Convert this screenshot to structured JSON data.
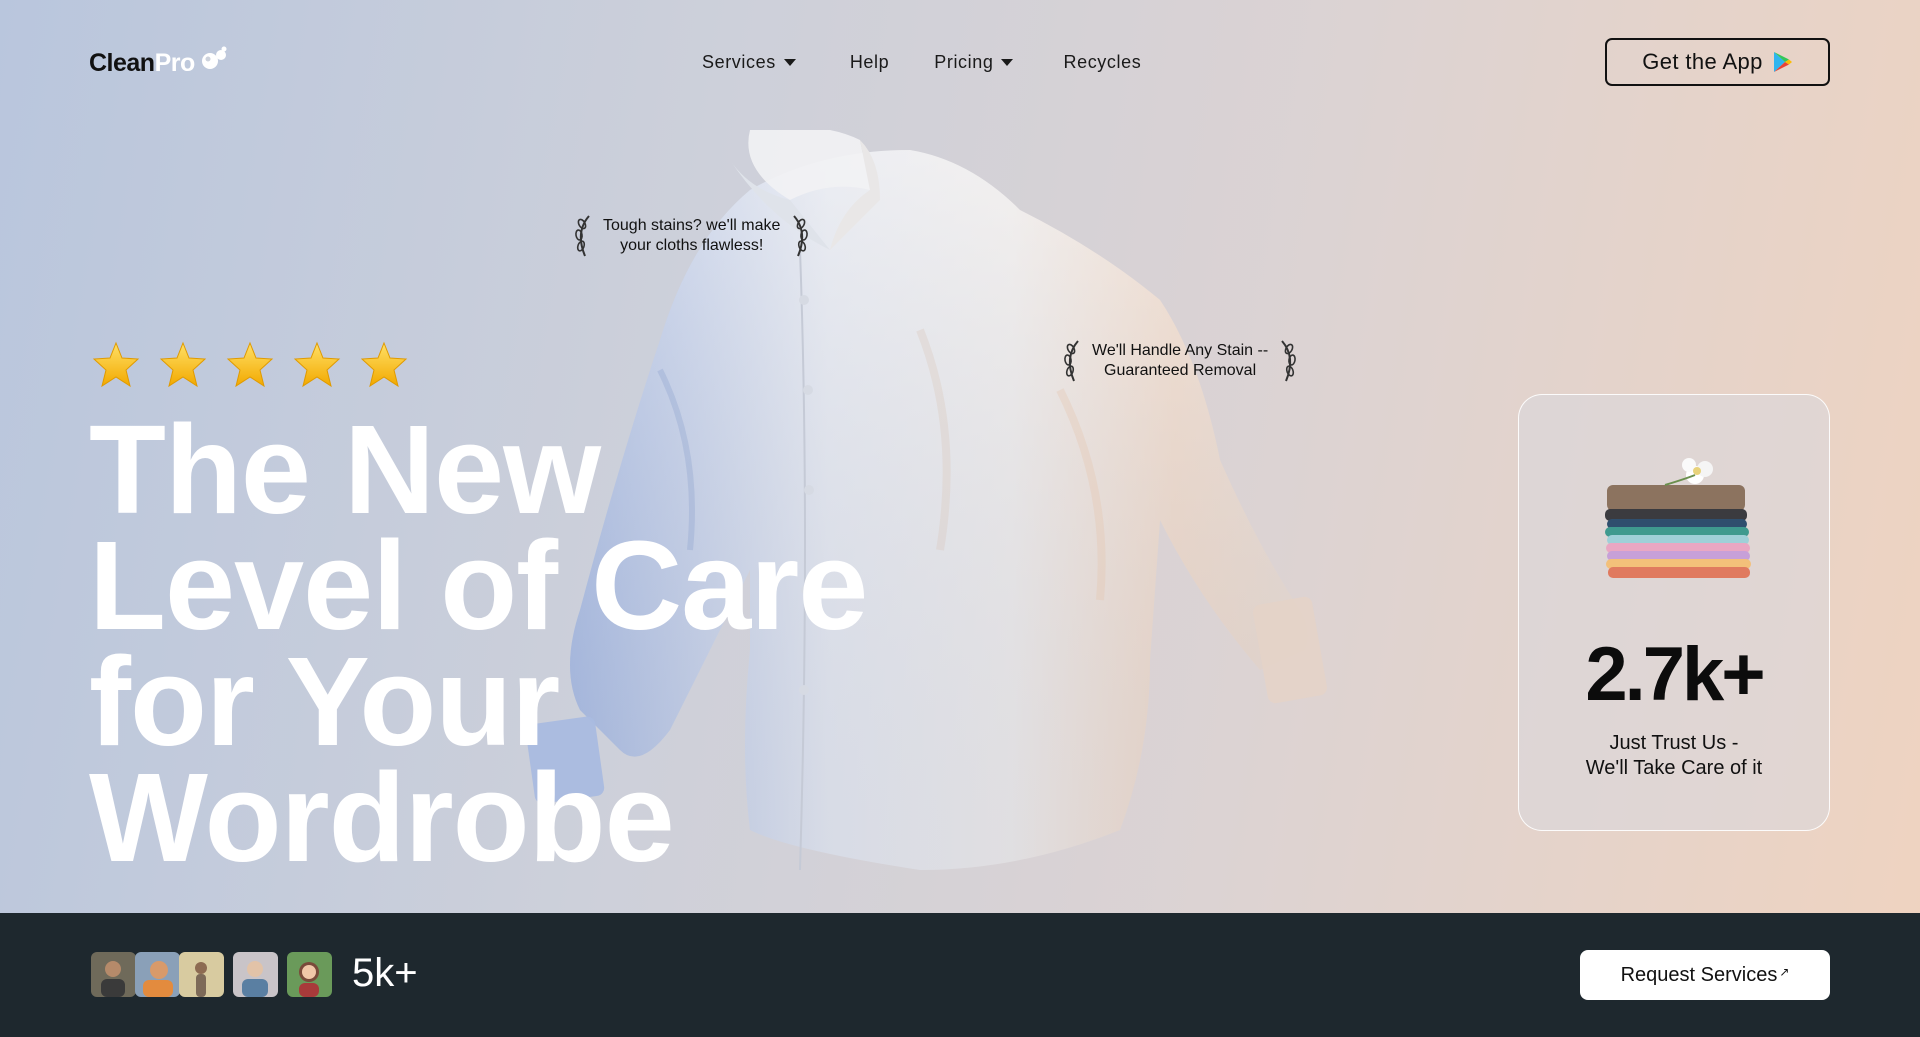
{
  "brand": {
    "part1": "Clean",
    "part2": "Pro"
  },
  "nav": {
    "items": [
      {
        "label": "Services",
        "dropdown": true
      },
      {
        "label": "Help",
        "dropdown": false
      },
      {
        "label": "Pricing",
        "dropdown": true
      },
      {
        "label": "Recycles",
        "dropdown": false
      }
    ],
    "cta": "Get the App",
    "cta_icon": "play-store-icon"
  },
  "hero": {
    "rating_stars": 5,
    "headline": [
      "The New",
      "Level of Care",
      "for Your",
      "Wordrobe"
    ],
    "quote1": [
      "Tough stains? we'll make",
      "your cloths flawless!"
    ],
    "quote2": [
      "We'll Handle Any Stain --",
      "Guaranteed Removal"
    ]
  },
  "stat_card": {
    "value": "2.7k+",
    "caption": [
      "Just Trust Us -",
      "We'll Take Care of it"
    ]
  },
  "footer_bar": {
    "customer_count": "5k+",
    "request_button": "Request Services",
    "request_icon": "arrow-up-right-icon"
  },
  "colors": {
    "accent_dark": "#1e282e",
    "headline": "#ffffff",
    "bg_left": "#b9c6dd",
    "bg_right": "#efd3c0"
  }
}
